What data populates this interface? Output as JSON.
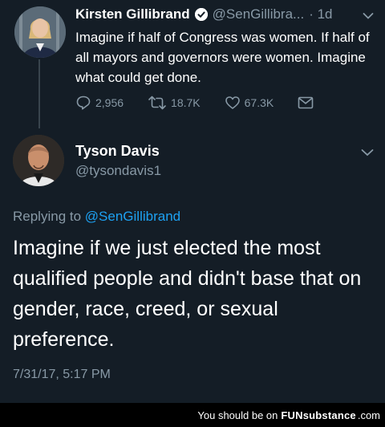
{
  "tweet1": {
    "name": "Kirsten Gillibrand",
    "handle": "@SenGillibra...",
    "time": "· 1d",
    "text": "Imagine if half of Congress was women. If half of all mayors and governors were women. Imagine what could get done.",
    "replies": "2,956",
    "retweets": "18.7K",
    "likes": "67.3K",
    "icons": [
      "verified-icon",
      "chevron-down-icon",
      "reply-icon",
      "retweet-icon",
      "like-icon",
      "message-icon"
    ]
  },
  "tweet2": {
    "name": "Tyson Davis",
    "handle": "@tysondavis1",
    "replying_prefix": "Replying to",
    "replying_mention": "@SenGillibrand",
    "text": "Imagine if we just elected the most qualified people and didn't base that on gender, race, creed, or sexual preference.",
    "timestamp": "7/31/17, 5:17 PM"
  },
  "footer": {
    "prefix": "You should be on",
    "brand": "FUNsubstance",
    "suffix": ".com"
  },
  "colors": {
    "background": "#141d26",
    "muted": "#8899a6",
    "link": "#1da1f2",
    "verified": "#1da1f2"
  }
}
